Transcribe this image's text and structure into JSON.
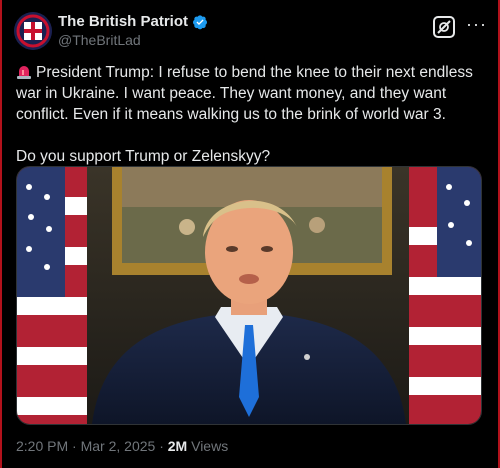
{
  "author": {
    "display_name": "The British Patriot",
    "handle": "@TheBritLad"
  },
  "tweet": {
    "icon": "siren-emoji",
    "paragraph1": "President Trump: I refuse to bend the knee to their next endless war in Ukraine. I want peace. They want money, and they want conflict. Even if it means walking us to the brink of world war 3.",
    "paragraph2": "Do you support Trump or Zelenskyy?"
  },
  "meta": {
    "time": "2:20 PM",
    "separator": "·",
    "date": "Mar 2, 2025",
    "views_count": "2M",
    "views_label": "Views"
  },
  "colors": {
    "background": "#000000",
    "text": "#e7e9ea",
    "muted": "#71767b",
    "verified": "#1d9bf0",
    "frame": "#b3121c"
  }
}
